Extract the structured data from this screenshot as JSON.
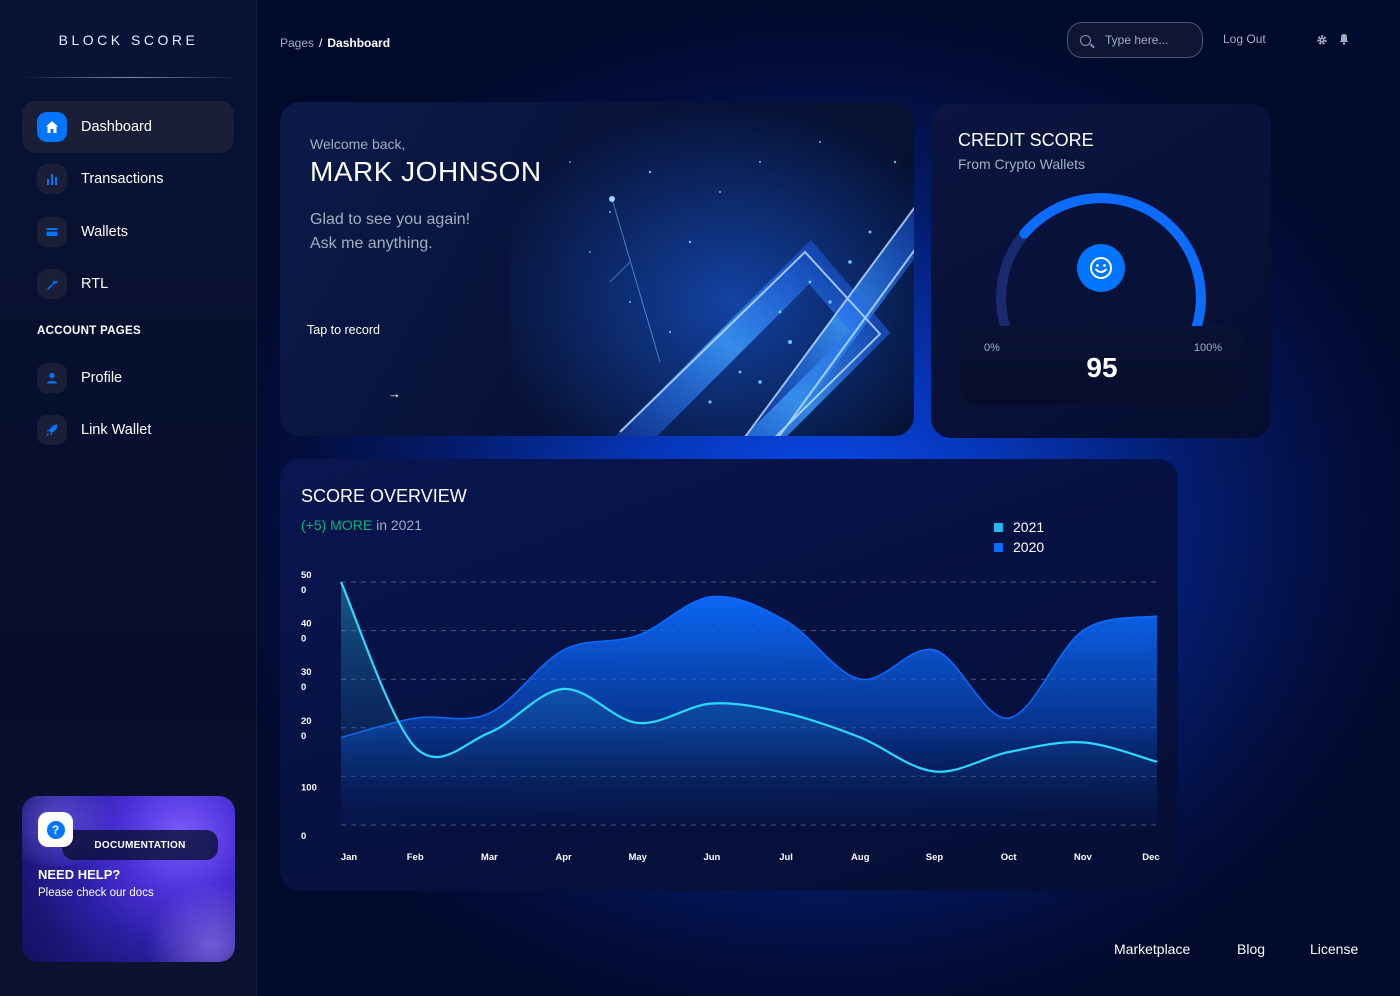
{
  "brand": {
    "logo_text": "BLOCK SCORE"
  },
  "sidebar": {
    "items": [
      {
        "label": "Dashboard",
        "icon": "home-icon",
        "active": true
      },
      {
        "label": "Transactions",
        "icon": "bar-chart-icon",
        "active": false
      },
      {
        "label": "Wallets",
        "icon": "credit-card-icon",
        "active": false
      },
      {
        "label": "RTL",
        "icon": "wrench-icon",
        "active": false
      }
    ],
    "section_label": "ACCOUNT PAGES",
    "account_items": [
      {
        "label": "Profile",
        "icon": "user-icon"
      },
      {
        "label": "Link Wallet",
        "icon": "rocket-icon"
      }
    ],
    "help": {
      "badge": "DOCUMENTATION",
      "title": "NEED HELP?",
      "subtitle": "Please check our docs",
      "icon": "question-icon"
    }
  },
  "header": {
    "breadcrumb": {
      "parent": "Pages",
      "separator": "/",
      "current": "Dashboard"
    },
    "search_placeholder": "Type here...",
    "logout_label": "Log Out",
    "icons": [
      "settings-icon",
      "bell-icon"
    ]
  },
  "welcome": {
    "greeting": "Welcome back,",
    "name": "MARK JOHNSON",
    "message_line1": "Glad to see you again!",
    "message_line2": "Ask me anything.",
    "cta": "Tap to record",
    "arrow": "→"
  },
  "credit": {
    "title": "CREDIT SCORE",
    "subtitle": "From Crypto Wallets",
    "min_label": "0%",
    "max_label": "100%",
    "score": "95",
    "score_fraction": 0.95
  },
  "overview": {
    "title": "SCORE OVERVIEW",
    "delta": "(+5) MORE",
    "delta_suffix": " in 2021",
    "accent_green": "#01b574"
  },
  "chart_data": {
    "type": "area",
    "categories": [
      "Jan",
      "Feb",
      "Mar",
      "Apr",
      "May",
      "Jun",
      "Jul",
      "Aug",
      "Sep",
      "Oct",
      "Nov",
      "Dec"
    ],
    "y_tick_labels": [
      "0",
      "100",
      "20\n0",
      "30\n0",
      "40\n0",
      "50\n0"
    ],
    "y_tick_values": [
      0,
      100,
      200,
      300,
      400,
      500
    ],
    "ylim": [
      0,
      500
    ],
    "grid": true,
    "legend_position": "top-right",
    "series": [
      {
        "name": "2021",
        "color": "#2cd9ff",
        "values": [
          500,
          160,
          190,
          280,
          210,
          250,
          230,
          180,
          110,
          150,
          170,
          130
        ]
      },
      {
        "name": "2020",
        "color": "#0a6cff",
        "values": [
          180,
          220,
          230,
          360,
          390,
          470,
          420,
          300,
          360,
          220,
          400,
          430
        ]
      }
    ]
  },
  "footer": {
    "links": [
      "Marketplace",
      "Blog",
      "License"
    ]
  }
}
